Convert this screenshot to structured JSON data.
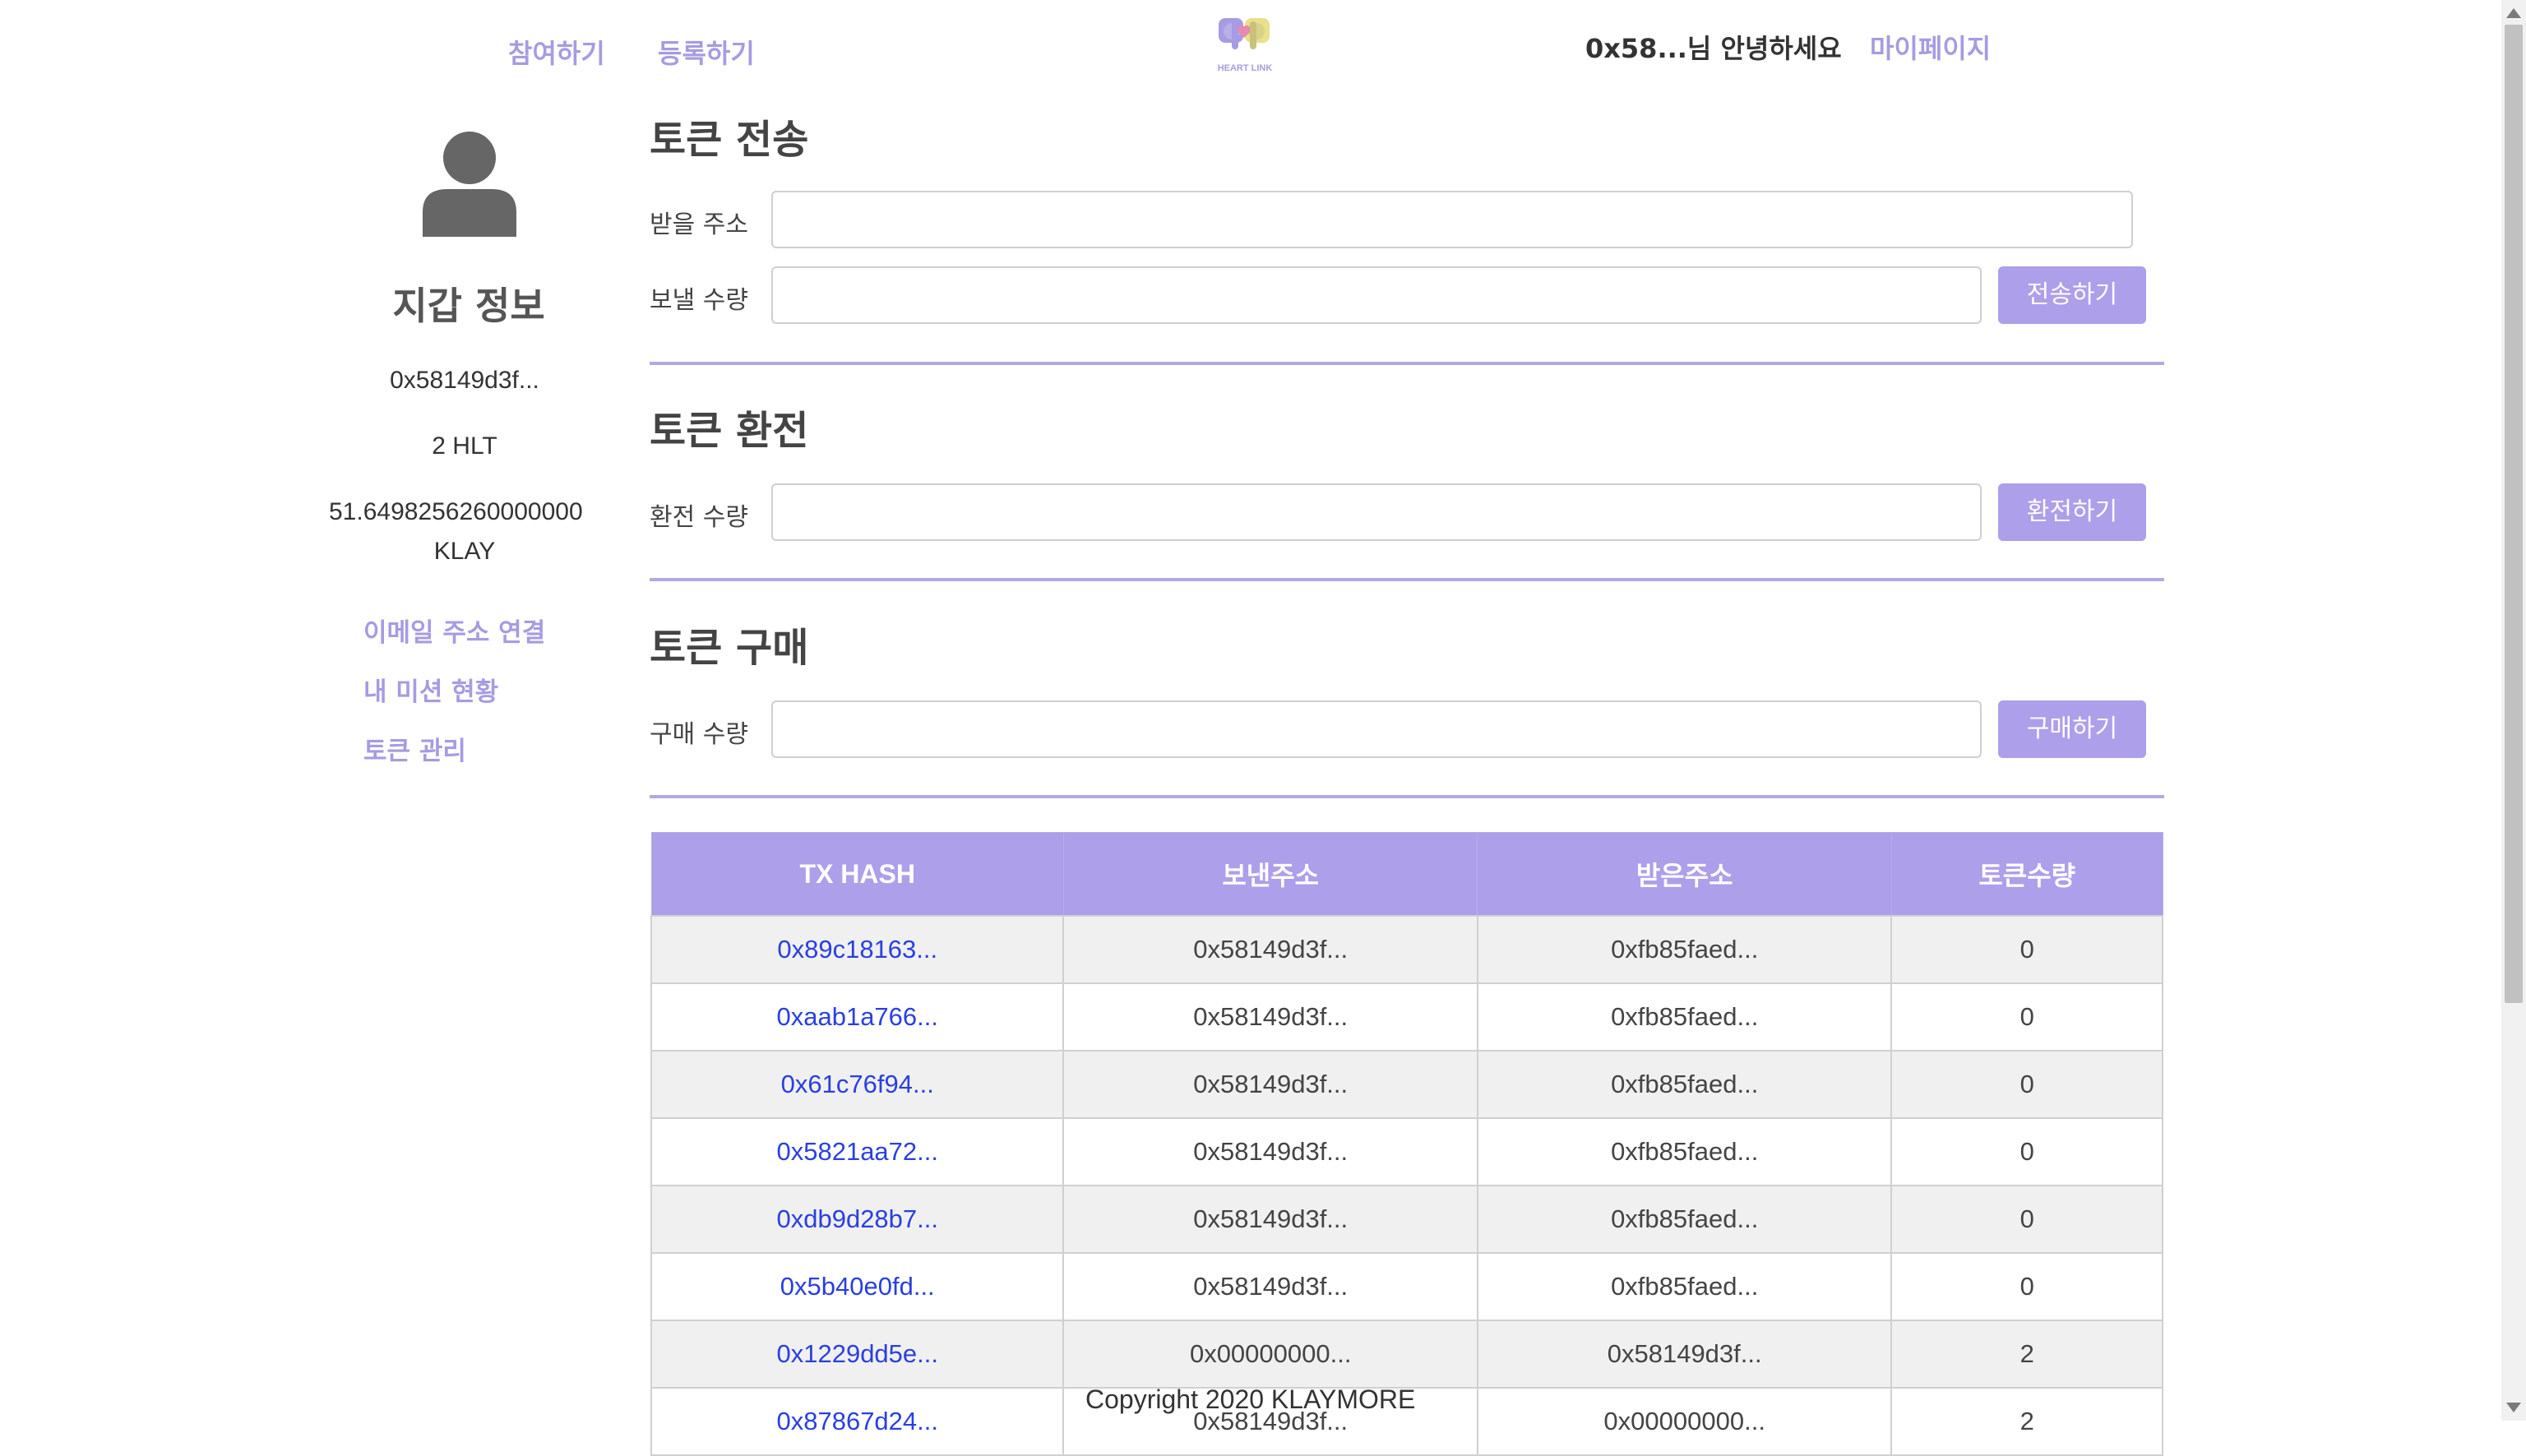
{
  "header": {
    "nav": [
      "참여하기",
      "등록하기"
    ],
    "logo_text": "HEART LINK",
    "greeting": "0x58...님 안녕하세요",
    "mypage": "마이페이지"
  },
  "sidebar": {
    "title": "지갑 정보",
    "address": "0x58149d3f...",
    "hlt": "2 HLT",
    "klay_amount": "51.6498256260000000",
    "klay_unit": "KLAY",
    "links": [
      "이메일 주소 연결",
      "내 미션 현황",
      "토큰 관리"
    ]
  },
  "transfer": {
    "title": "토큰 전송",
    "to_label": "받을 주소",
    "amount_label": "보낼 수량",
    "button": "전송하기"
  },
  "exchange": {
    "title": "토큰 환전",
    "amount_label": "환전 수량",
    "button": "환전하기"
  },
  "purchase": {
    "title": "토큰 구매",
    "amount_label": "구매 수량",
    "button": "구매하기"
  },
  "table": {
    "headers": [
      "TX HASH",
      "보낸주소",
      "받은주소",
      "토큰수량"
    ],
    "rows": [
      [
        "0x89c18163...",
        "0x58149d3f...",
        "0xfb85faed...",
        "0"
      ],
      [
        "0xaab1a766...",
        "0x58149d3f...",
        "0xfb85faed...",
        "0"
      ],
      [
        "0x61c76f94...",
        "0x58149d3f...",
        "0xfb85faed...",
        "0"
      ],
      [
        "0x5821aa72...",
        "0x58149d3f...",
        "0xfb85faed...",
        "0"
      ],
      [
        "0xdb9d28b7...",
        "0x58149d3f...",
        "0xfb85faed...",
        "0"
      ],
      [
        "0x5b40e0fd...",
        "0x58149d3f...",
        "0xfb85faed...",
        "0"
      ],
      [
        "0x1229dd5e...",
        "0x00000000...",
        "0x58149d3f...",
        "2"
      ],
      [
        "0x87867d24...",
        "0x58149d3f...",
        "0x00000000...",
        "2"
      ]
    ]
  },
  "footer": "Copyright 2020 KLAYMORE"
}
